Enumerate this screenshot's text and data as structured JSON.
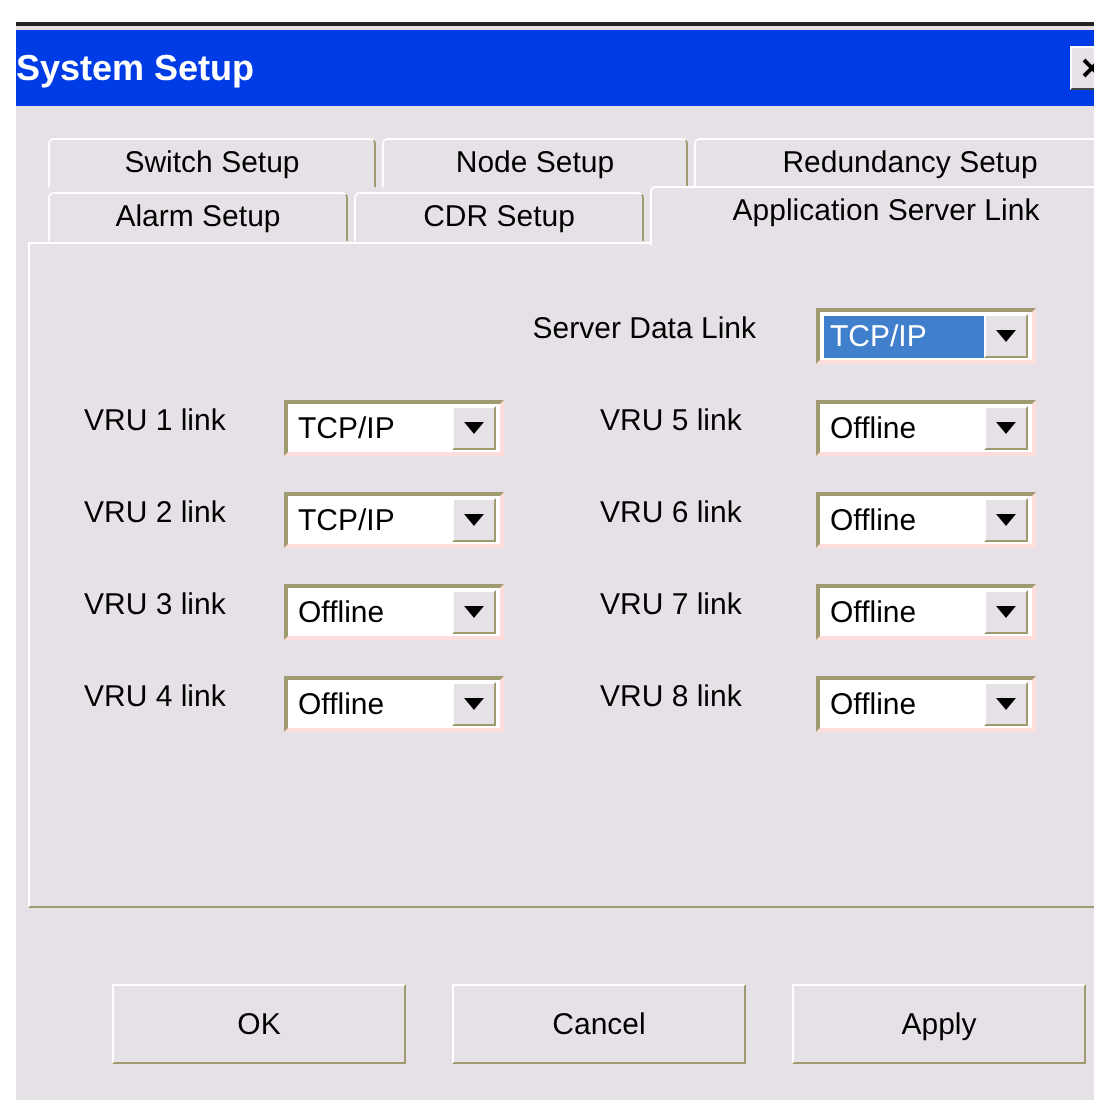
{
  "window": {
    "title": "System Setup"
  },
  "tab_rows": [
    [
      {
        "label": "Switch Setup",
        "selected": false
      },
      {
        "label": "Node Setup",
        "selected": false
      },
      {
        "label": "Redundancy Setup",
        "selected": false
      }
    ],
    [
      {
        "label": "Alarm Setup",
        "selected": false
      },
      {
        "label": "CDR Setup",
        "selected": false
      },
      {
        "label": "Application Server Link",
        "selected": true
      }
    ]
  ],
  "server_data_link": {
    "label": "Server Data Link",
    "value": "TCP/IP",
    "focused": true
  },
  "links": [
    {
      "label": "VRU 1 link",
      "value": "TCP/IP",
      "focused": false
    },
    {
      "label": "VRU 5 link",
      "value": "Offline",
      "focused": false
    },
    {
      "label": "VRU 2 link",
      "value": "TCP/IP",
      "focused": false
    },
    {
      "label": "VRU 6 link",
      "value": "Offline",
      "focused": false
    },
    {
      "label": "VRU 3 link",
      "value": "Offline",
      "focused": false
    },
    {
      "label": "VRU 7 link",
      "value": "Offline",
      "focused": false
    },
    {
      "label": "VRU 4 link",
      "value": "Offline",
      "focused": false
    },
    {
      "label": "VRU 8 link",
      "value": "Offline",
      "focused": false
    }
  ],
  "buttons": [
    "OK",
    "Cancel",
    "Apply"
  ]
}
